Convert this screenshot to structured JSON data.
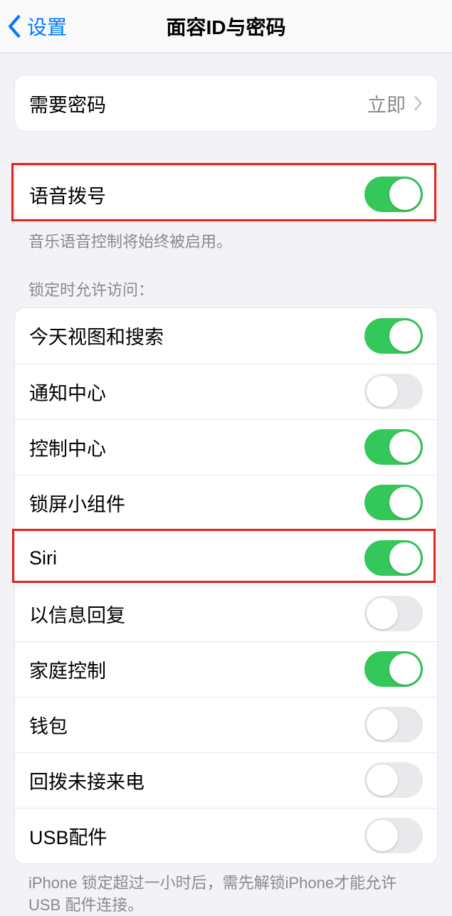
{
  "nav": {
    "back_label": "设置",
    "title": "面容ID与密码"
  },
  "passcode_row": {
    "label": "需要密码",
    "value": "立即"
  },
  "voice_dial": {
    "label": "语音拨号",
    "enabled": true,
    "footer": "音乐语音控制将始终被启用。"
  },
  "locked_section": {
    "header": "锁定时允许访问：",
    "items": [
      {
        "label": "今天视图和搜索",
        "enabled": true
      },
      {
        "label": "通知中心",
        "enabled": false
      },
      {
        "label": "控制中心",
        "enabled": true
      },
      {
        "label": "锁屏小组件",
        "enabled": true
      },
      {
        "label": "Siri",
        "enabled": true
      },
      {
        "label": "以信息回复",
        "enabled": false
      },
      {
        "label": "家庭控制",
        "enabled": true
      },
      {
        "label": "钱包",
        "enabled": false
      },
      {
        "label": "回拨未接来电",
        "enabled": false
      },
      {
        "label": "USB配件",
        "enabled": false
      }
    ],
    "footer": "iPhone 锁定超过一小时后，需先解锁iPhone才能允许USB 配件连接。"
  },
  "highlights": {
    "voice_dial": true,
    "siri_index": 4
  }
}
